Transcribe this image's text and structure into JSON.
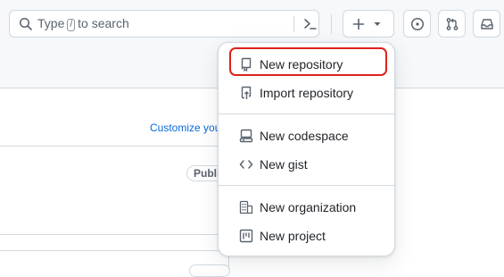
{
  "header": {
    "search": {
      "placeholder_before": "Type",
      "key": "/",
      "placeholder_after": "to search",
      "search_icon": "search-icon",
      "command_icon": "command-palette-icon"
    },
    "buttons": {
      "create": {
        "icons": [
          "plus-icon",
          "triangle-down-icon"
        ]
      },
      "issues": {
        "icon": "issue-opened-icon"
      },
      "pull_requests": {
        "icon": "git-pull-request-icon"
      },
      "inbox": {
        "icon": "inbox-icon"
      }
    }
  },
  "page": {
    "customize_link": "Customize your",
    "visibility_badge": "Public"
  },
  "create_menu": {
    "groups": [
      [
        {
          "label": "New repository",
          "icon": "repo-icon",
          "highlighted": true
        },
        {
          "label": "Import repository",
          "icon": "repo-push-icon"
        }
      ],
      [
        {
          "label": "New codespace",
          "icon": "codespaces-icon"
        },
        {
          "label": "New gist",
          "icon": "code-icon"
        }
      ],
      [
        {
          "label": "New organization",
          "icon": "organization-icon"
        },
        {
          "label": "New project",
          "icon": "project-icon"
        }
      ]
    ]
  },
  "colors": {
    "text": "#1f2328",
    "muted": "#59636e",
    "border": "#d1d9e0",
    "link": "#0969da",
    "annotation": "#e0201b"
  }
}
